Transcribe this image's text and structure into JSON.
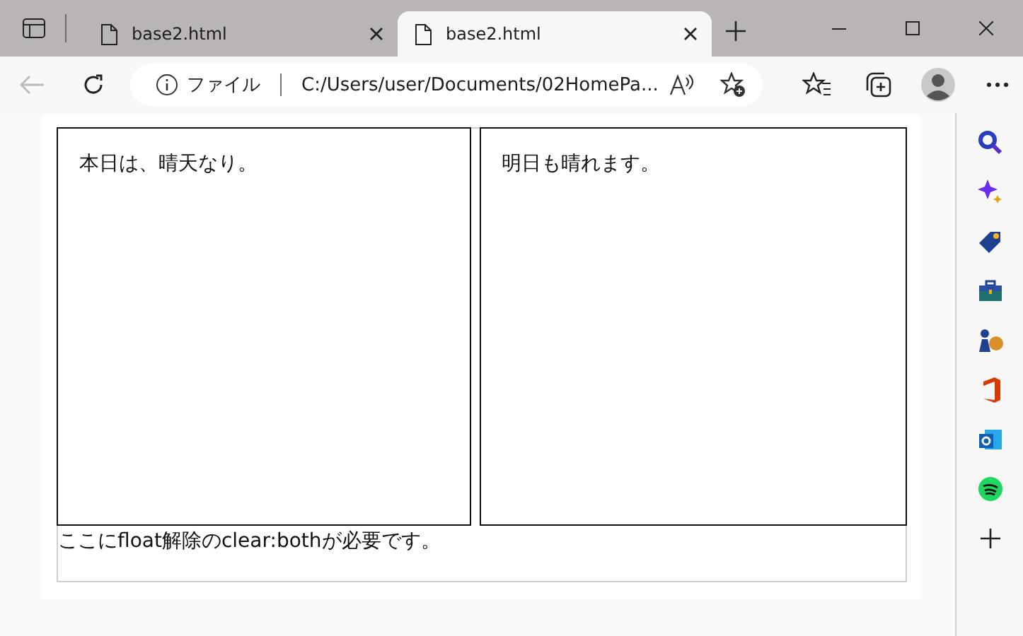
{
  "tabs": [
    {
      "title": "base2.html",
      "selected": false
    },
    {
      "title": "base2.html",
      "selected": true
    }
  ],
  "address_bar": {
    "scheme_label": "ファイル",
    "url": "C:/Users/user/Documents/02HomePa..."
  },
  "page": {
    "boxes": [
      "本日は、晴天なり。",
      "明日も晴れます。"
    ],
    "footer_text": "ここにfloat解除のclear:bothが必要です。"
  }
}
